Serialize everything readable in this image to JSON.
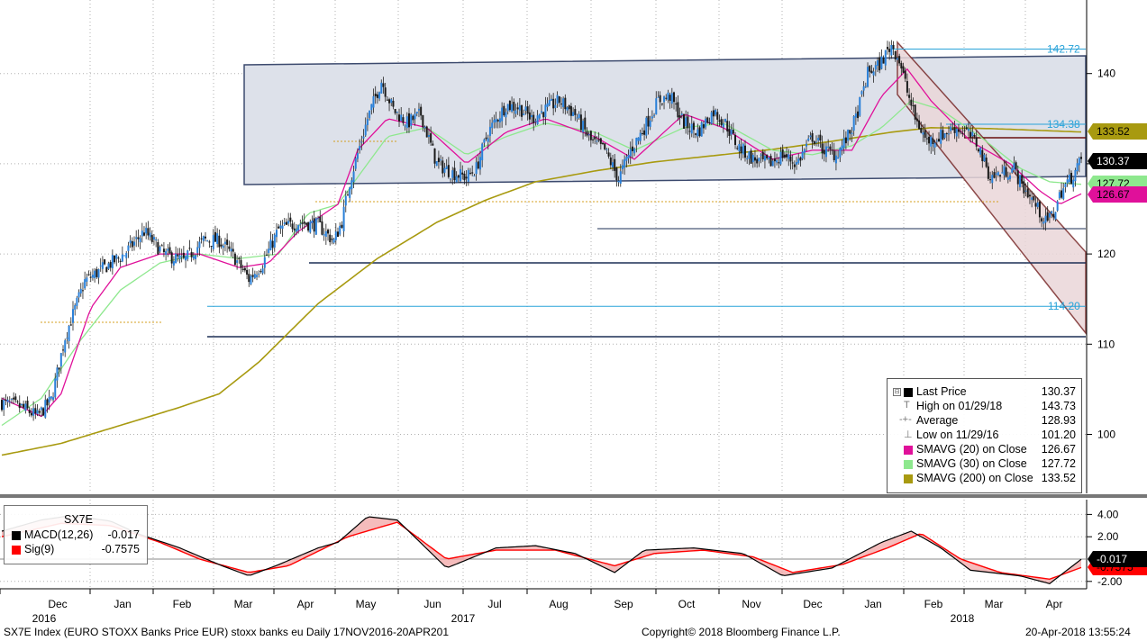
{
  "footer": {
    "left": "SX7E Index (EURO STOXX Banks Price EUR) stoxx banks eu  Daily 17NOV2016-20APR201",
    "center": "Copyright© 2018 Bloomberg Finance L.P.",
    "right": "20-Apr-2018 13:55:24"
  },
  "legend": {
    "rows": [
      {
        "name": "Last Price",
        "value": "130.37",
        "swatch": "#000000"
      },
      {
        "name": "High on 01/29/18",
        "value": "143.73",
        "icon": "T"
      },
      {
        "name": "Average",
        "value": "128.93",
        "icon": "-+-"
      },
      {
        "name": "Low on 11/29/16",
        "value": "101.20",
        "icon": "⊥"
      },
      {
        "name": "SMAVG (20) on Close",
        "value": "126.67",
        "swatch": "#e0109a"
      },
      {
        "name": "SMAVG (30) on Close",
        "value": "127.72",
        "swatch": "#8ee88e"
      },
      {
        "name": "SMAVG (200) on Close",
        "value": "133.52",
        "swatch": "#a89a10"
      }
    ]
  },
  "macd_legend": {
    "title": "SX7E",
    "rows": [
      {
        "name": "MACD(12,26)",
        "value": "-0.017",
        "swatch": "#000000"
      },
      {
        "name": "Sig(9)",
        "value": "-0.7575",
        "swatch": "#ff0000"
      }
    ]
  },
  "chart_data": [
    {
      "type": "candlestick",
      "title": "",
      "ylim": [
        95,
        148
      ],
      "yticks": [
        "100",
        "110",
        "120",
        "130",
        "140"
      ],
      "x_month_labels": [
        "Dec",
        "Jan",
        "Feb",
        "Mar",
        "Apr",
        "May",
        "Jun",
        "Jul",
        "Aug",
        "Sep",
        "Oct",
        "Nov",
        "Dec",
        "Jan",
        "Feb",
        "Mar",
        "Apr"
      ],
      "x_year_labels": [
        "2016",
        "2017",
        "2018"
      ],
      "last_price": 130.37,
      "high": 143.73,
      "average": 128.93,
      "low": 101.2,
      "level_labels": [
        "142.72",
        "134.38",
        "114.20"
      ],
      "right_tags": [
        {
          "label": "133.52",
          "color": "#a89a10"
        },
        {
          "label": "130.37",
          "color": "#000000"
        },
        {
          "label": "127.72",
          "color": "#8ee88e"
        },
        {
          "label": "126.67",
          "color": "#e0109a"
        }
      ],
      "price_anchors": [
        [
          0,
          103.5
        ],
        [
          10,
          103.0
        ],
        [
          18,
          102.0
        ],
        [
          25,
          103.8
        ],
        [
          32,
          110.8
        ],
        [
          42,
          117.0
        ],
        [
          52,
          118.5
        ],
        [
          62,
          120.0
        ],
        [
          72,
          122.5
        ],
        [
          82,
          120.0
        ],
        [
          92,
          119.2
        ],
        [
          102,
          121.5
        ],
        [
          110,
          121.5
        ],
        [
          118,
          119.5
        ],
        [
          125,
          117.2
        ],
        [
          132,
          119.0
        ],
        [
          140,
          122.7
        ],
        [
          150,
          123.5
        ],
        [
          160,
          123.2
        ],
        [
          168,
          121.4
        ],
        [
          172,
          123.6
        ],
        [
          176,
          128.0
        ],
        [
          185,
          135.0
        ],
        [
          192,
          139.2
        ],
        [
          198,
          136.0
        ],
        [
          205,
          134.5
        ],
        [
          212,
          135.5
        ],
        [
          220,
          130.0
        ],
        [
          228,
          129.0
        ],
        [
          235,
          128.5
        ],
        [
          240,
          129.5
        ],
        [
          246,
          133.5
        ],
        [
          255,
          136.5
        ],
        [
          262,
          136.2
        ],
        [
          268,
          135.0
        ],
        [
          275,
          136.0
        ],
        [
          282,
          137.0
        ],
        [
          290,
          135.5
        ],
        [
          298,
          132.5
        ],
        [
          305,
          131.5
        ],
        [
          312,
          128.3
        ],
        [
          318,
          131.5
        ],
        [
          325,
          134.0
        ],
        [
          332,
          137.0
        ],
        [
          338,
          137.5
        ],
        [
          345,
          134.5
        ],
        [
          352,
          133.5
        ],
        [
          360,
          135.8
        ],
        [
          366,
          134.5
        ],
        [
          372,
          132.0
        ],
        [
          380,
          130.5
        ],
        [
          388,
          130.0
        ],
        [
          395,
          131.0
        ],
        [
          402,
          130.0
        ],
        [
          410,
          133.0
        ],
        [
          416,
          131.5
        ],
        [
          422,
          131.0
        ],
        [
          428,
          133.0
        ],
        [
          432,
          135.0
        ],
        [
          438,
          140.0
        ],
        [
          444,
          141.0
        ],
        [
          450,
          143.2
        ],
        [
          454,
          141.5
        ],
        [
          458,
          138.0
        ],
        [
          462,
          135.0
        ],
        [
          468,
          132.5
        ],
        [
          474,
          133.0
        ],
        [
          482,
          134.0
        ],
        [
          488,
          133.5
        ],
        [
          494,
          132.0
        ],
        [
          500,
          128.5
        ],
        [
          506,
          129.0
        ],
        [
          512,
          129.5
        ],
        [
          516,
          127.5
        ],
        [
          520,
          126.5
        ],
        [
          524,
          125.0
        ],
        [
          528,
          123.5
        ],
        [
          532,
          124.5
        ],
        [
          536,
          127.0
        ],
        [
          541,
          128.5
        ],
        [
          546,
          130.37
        ]
      ],
      "candles_drawn_count": 547,
      "sma20_anchors": [
        [
          0,
          104.0
        ],
        [
          20,
          102.0
        ],
        [
          30,
          104.5
        ],
        [
          45,
          114.0
        ],
        [
          60,
          118.5
        ],
        [
          80,
          120.0
        ],
        [
          100,
          120.0
        ],
        [
          120,
          118.5
        ],
        [
          135,
          119.0
        ],
        [
          150,
          122.5
        ],
        [
          170,
          125.5
        ],
        [
          180,
          131.5
        ],
        [
          195,
          135.0
        ],
        [
          215,
          134.0
        ],
        [
          235,
          130.0
        ],
        [
          255,
          133.5
        ],
        [
          275,
          135.0
        ],
        [
          300,
          133.0
        ],
        [
          320,
          130.5
        ],
        [
          345,
          135.5
        ],
        [
          365,
          134.0
        ],
        [
          390,
          130.5
        ],
        [
          410,
          131.5
        ],
        [
          430,
          131.5
        ],
        [
          445,
          137.5
        ],
        [
          458,
          140.5
        ],
        [
          470,
          137.0
        ],
        [
          490,
          132.5
        ],
        [
          510,
          130.0
        ],
        [
          525,
          127.0
        ],
        [
          535,
          125.5
        ],
        [
          546,
          126.67
        ]
      ],
      "sma30_anchors": [
        [
          0,
          101.0
        ],
        [
          20,
          104.0
        ],
        [
          40,
          110.5
        ],
        [
          60,
          116.0
        ],
        [
          80,
          119.0
        ],
        [
          100,
          120.0
        ],
        [
          120,
          119.5
        ],
        [
          140,
          120.0
        ],
        [
          155,
          124.5
        ],
        [
          170,
          125.5
        ],
        [
          180,
          128.5
        ],
        [
          195,
          133.0
        ],
        [
          215,
          134.0
        ],
        [
          235,
          131.0
        ],
        [
          255,
          133.0
        ],
        [
          275,
          134.5
        ],
        [
          300,
          133.5
        ],
        [
          320,
          131.5
        ],
        [
          345,
          134.0
        ],
        [
          365,
          134.5
        ],
        [
          390,
          131.5
        ],
        [
          410,
          131.0
        ],
        [
          430,
          132.0
        ],
        [
          445,
          134.0
        ],
        [
          460,
          137.0
        ],
        [
          475,
          136.0
        ],
        [
          495,
          133.0
        ],
        [
          515,
          129.5
        ],
        [
          530,
          128.0
        ],
        [
          546,
          127.72
        ]
      ],
      "sma200_anchors": [
        [
          0,
          97.7
        ],
        [
          30,
          99.0
        ],
        [
          60,
          101.0
        ],
        [
          90,
          103.0
        ],
        [
          110,
          104.5
        ],
        [
          130,
          108.0
        ],
        [
          160,
          114.5
        ],
        [
          190,
          119.5
        ],
        [
          220,
          123.5
        ],
        [
          245,
          126.0
        ],
        [
          270,
          128.0
        ],
        [
          300,
          129.2
        ],
        [
          330,
          130.2
        ],
        [
          360,
          130.9
        ],
        [
          390,
          131.6
        ],
        [
          420,
          132.5
        ],
        [
          450,
          133.5
        ],
        [
          470,
          134.0
        ],
        [
          500,
          133.9
        ],
        [
          546,
          133.52
        ]
      ]
    },
    {
      "type": "area",
      "title": "",
      "ylim": [
        -3,
        5
      ],
      "yticks": [
        "4.00",
        "2.00",
        "-2.00"
      ],
      "right_tags": [
        {
          "label": "-0.017",
          "color": "#000000"
        },
        {
          "label": "-0.7575",
          "color": "#ff0000"
        }
      ],
      "series": [
        {
          "name": "MACD(12,26)",
          "color": "#000000",
          "anchors": [
            [
              0,
              2.5
            ],
            [
              20,
              3.5
            ],
            [
              35,
              3.9
            ],
            [
              55,
              3.4
            ],
            [
              70,
              2.2
            ],
            [
              90,
              1.0
            ],
            [
              110,
              -0.5
            ],
            [
              125,
              -1.5
            ],
            [
              140,
              -0.5
            ],
            [
              160,
              1.0
            ],
            [
              170,
              1.5
            ],
            [
              185,
              3.8
            ],
            [
              200,
              3.5
            ],
            [
              225,
              -0.8
            ],
            [
              250,
              1.0
            ],
            [
              270,
              1.2
            ],
            [
              290,
              0.5
            ],
            [
              310,
              -1.2
            ],
            [
              325,
              0.8
            ],
            [
              350,
              1.0
            ],
            [
              375,
              0.5
            ],
            [
              395,
              -1.5
            ],
            [
              420,
              -0.8
            ],
            [
              445,
              1.5
            ],
            [
              460,
              2.5
            ],
            [
              475,
              1.0
            ],
            [
              490,
              -1.0
            ],
            [
              515,
              -1.5
            ],
            [
              530,
              -2.2
            ],
            [
              546,
              -0.017
            ]
          ]
        },
        {
          "name": "Sig(9)",
          "color": "#ff0000",
          "anchors": [
            [
              0,
              2.0
            ],
            [
              30,
              3.2
            ],
            [
              55,
              3.0
            ],
            [
              80,
              1.5
            ],
            [
              100,
              0.0
            ],
            [
              125,
              -1.2
            ],
            [
              145,
              -0.6
            ],
            [
              175,
              2.0
            ],
            [
              200,
              3.3
            ],
            [
              225,
              0.0
            ],
            [
              250,
              0.8
            ],
            [
              280,
              0.8
            ],
            [
              310,
              -0.6
            ],
            [
              330,
              0.5
            ],
            [
              355,
              0.8
            ],
            [
              380,
              0.2
            ],
            [
              400,
              -1.2
            ],
            [
              425,
              -0.5
            ],
            [
              448,
              1.0
            ],
            [
              465,
              2.3
            ],
            [
              485,
              0.0
            ],
            [
              505,
              -1.2
            ],
            [
              530,
              -1.8
            ],
            [
              546,
              -0.7575
            ]
          ]
        }
      ]
    }
  ]
}
